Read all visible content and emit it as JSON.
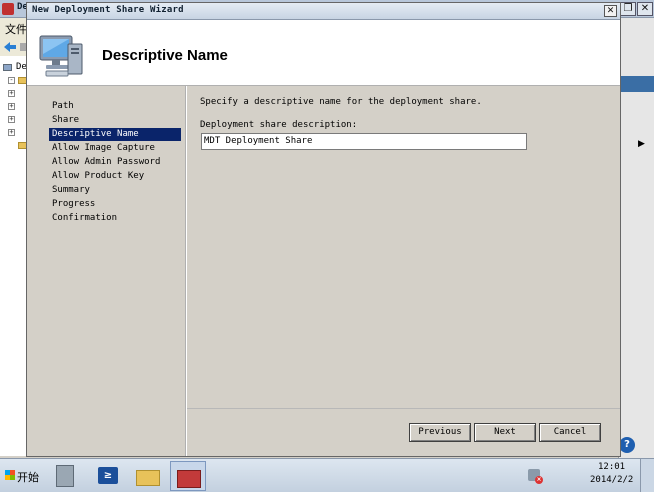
{
  "background_window": {
    "title": "De",
    "menu_label": "文件",
    "tree_root_label": "De"
  },
  "wizard": {
    "title": "New Deployment Share Wizard",
    "heading": "Descriptive Name",
    "steps": [
      "Path",
      "Share",
      "Descriptive Name",
      "Allow Image Capture",
      "Allow Admin Password",
      "Allow Product Key",
      "Summary",
      "Progress",
      "Confirmation"
    ],
    "active_step": "Descriptive Name",
    "instruction": "Specify a descriptive name for the deployment share.",
    "field_label": "Deployment share description:",
    "field_value": "MDT Deployment Share",
    "buttons": {
      "previous": "Previous",
      "next": "Next",
      "cancel": "Cancel"
    }
  },
  "taskbar": {
    "start_label": "开始",
    "time": "12:01",
    "date": "2014/2/2"
  },
  "icons": [
    "console-app-icon",
    "computer-monitor-icon",
    "server-manager-icon",
    "powershell-icon",
    "explorer-folder-icon",
    "toolbox-icon",
    "network-warning-icon",
    "help-icon"
  ]
}
